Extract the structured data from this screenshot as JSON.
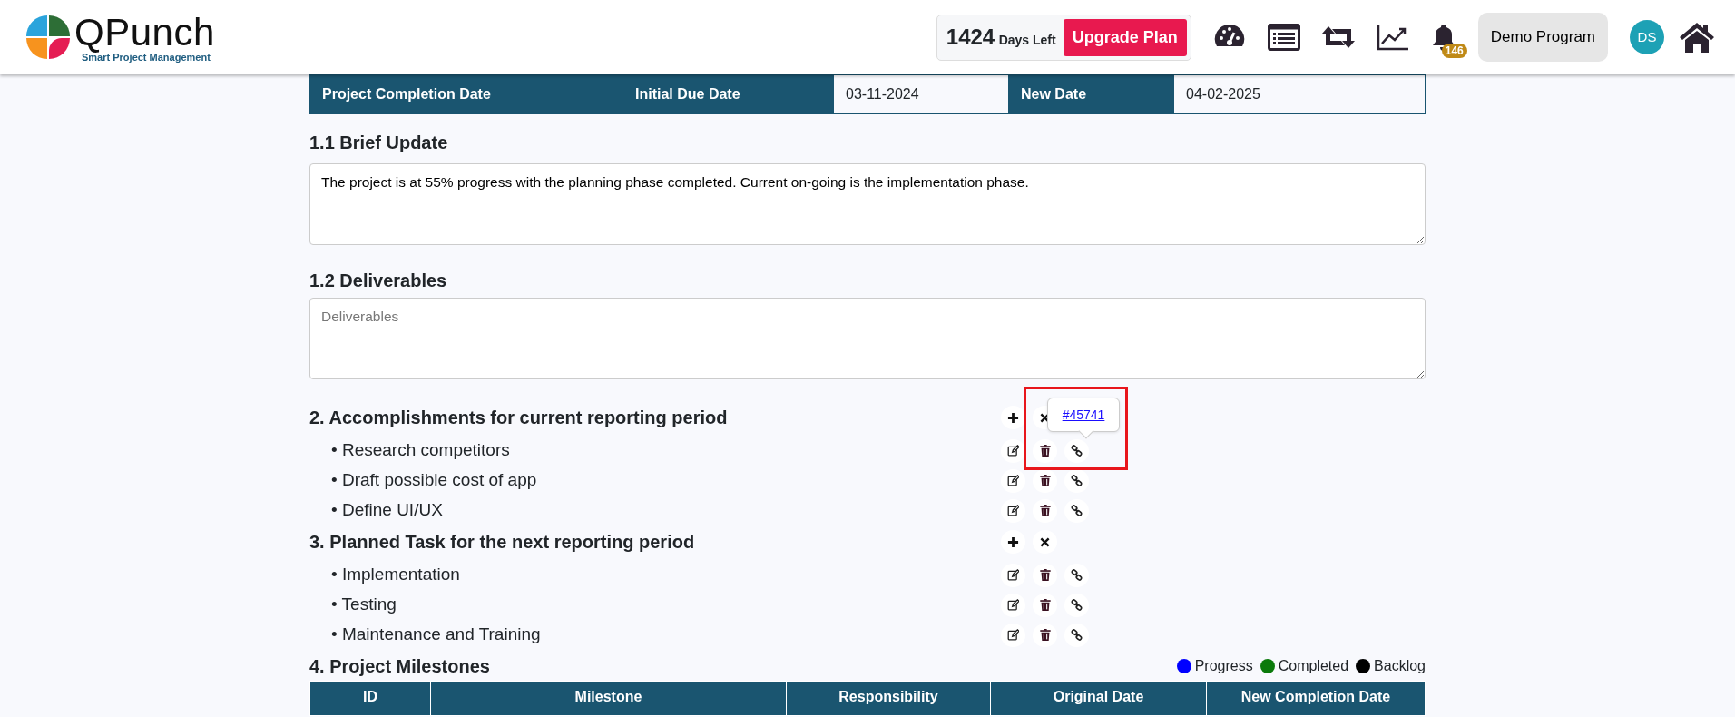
{
  "header": {
    "days_left": "1424",
    "days_left_label": "Days Left",
    "upgrade_button": "Upgrade Plan",
    "notification_count": "146",
    "program_button": "Demo Program",
    "avatar_initials": "DS",
    "logo_name": "QPunch",
    "logo_tagline": "Smart Project Management"
  },
  "completion_table": {
    "label": "Project Completion Date",
    "initial_label": "Initial Due Date",
    "initial_value": "03-11-2024",
    "new_label": "New Date",
    "new_value": "04-02-2025"
  },
  "brief_update": {
    "heading": "1.1 Brief Update",
    "value": "The project is at 55% progress with the planning phase completed. Current on-going is the implementation phase."
  },
  "deliverables": {
    "heading": "1.2 Deliverables",
    "placeholder": "Deliverables"
  },
  "sections": [
    {
      "heading": "2. Accomplishments for current reporting period",
      "items": [
        "• Research competitors",
        "• Draft possible cost of app",
        "• Define UI/UX"
      ]
    },
    {
      "heading": "3. Planned Task for the next reporting period",
      "items": [
        "• Implementation",
        "• Testing",
        "• Maintenance and Training"
      ]
    }
  ],
  "link_tooltip": {
    "text": "#45741",
    "highlighted": true
  },
  "milestones": {
    "heading": "4. Project Milestones",
    "legend": [
      {
        "label": "Progress",
        "color": "#0000ff"
      },
      {
        "label": "Completed",
        "color": "#0b7a0b"
      },
      {
        "label": "Backlog",
        "color": "#000000"
      }
    ],
    "columns": [
      "ID",
      "Milestone",
      "Responsibility",
      "Original Date",
      "New Completion Date"
    ]
  }
}
